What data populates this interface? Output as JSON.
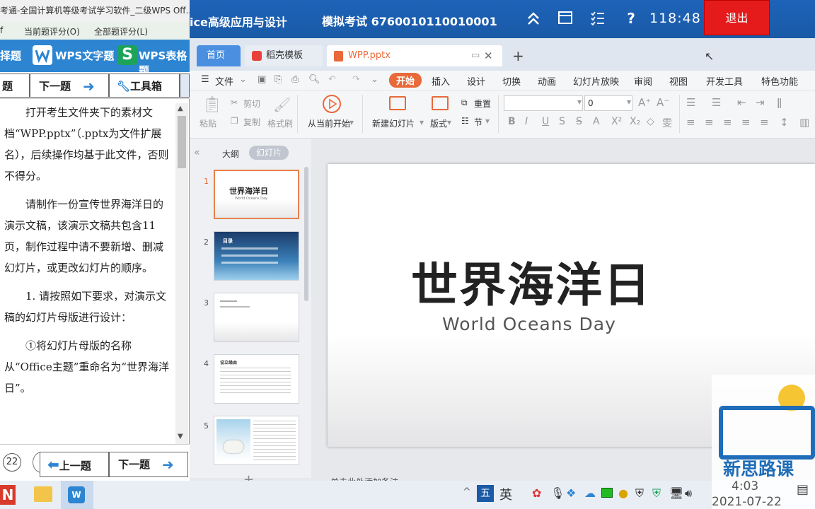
{
  "exam": {
    "title": "ice高级应用与设计",
    "mock_exam": "模拟考试 6760010110010001",
    "timer": "118:48",
    "exit_label": "退出"
  },
  "wps": {
    "tabs": [
      {
        "label": "首页"
      },
      {
        "label": "稻壳模板"
      },
      {
        "label": "WPP.pptx"
      }
    ],
    "menu": {
      "file": "文件",
      "items": [
        "开始",
        "插入",
        "设计",
        "切换",
        "动画",
        "幻灯片放映",
        "审阅",
        "视图",
        "开发工具",
        "特色功能"
      ],
      "active": "开始"
    },
    "ribbon": {
      "paste": "粘贴",
      "cut": "剪切",
      "copy": "复制",
      "format_painter": "格式刷",
      "play_from_current": "从当前开始",
      "new_slide": "新建幻灯片",
      "layout": "版式",
      "reset": "重置",
      "section": "节",
      "font_size": "0"
    },
    "pane_tabs": {
      "outline": "大纲",
      "slides": "幻灯片"
    },
    "thumbnails": [
      {
        "num": "1",
        "title": "世界海洋日",
        "subtitle": "World Oceans Day"
      },
      {
        "num": "2",
        "title": "目录"
      },
      {
        "num": "3"
      },
      {
        "num": "4",
        "title": "设立缘由"
      },
      {
        "num": "5"
      }
    ],
    "slide": {
      "title": "世界海洋日",
      "subtitle": "World Oceans Day"
    },
    "notes_placeholder": "单击此处添加备注"
  },
  "left": {
    "title": "考通-全国计算机等级考试学习软件_二级WPS Off...",
    "menu": [
      "f",
      "当前题评分(O)",
      "全部题评分(L)"
    ],
    "types": [
      "择题",
      "WPS文字题",
      "WPS表格题"
    ],
    "nav": {
      "prev": "题",
      "next": "下一题",
      "tools": "工具箱"
    },
    "paragraphs": [
      "打开考生文件夹下的素材文档“WPP.pptx”（.pptx为文件扩展名），后续操作均基于此文件，否则不得分。",
      "请制作一份宣传世界海洋日的演示文稿，该演示文稿共包含11页，制作过程中请不要新增、删减幻灯片，或更改幻灯片的顺序。",
      "1. 请按照如下要求，对演示文稿的幻灯片母版进行设计：",
      "①将幻灯片母版的名称从“Office主题”重命名为“世界海洋日”。"
    ],
    "bottom": {
      "page": "22",
      "prev": "上一题",
      "next": "下一题"
    }
  },
  "taskbar": {
    "ime": "五",
    "time": "4:03",
    "date": "2021-07-22"
  },
  "logo": {
    "text": "新思路课"
  },
  "colors": {
    "exam_bar": "#1d63b8",
    "exit": "#e51b1b",
    "wps_accent": "#e86a3a",
    "left_types": "#2d85d2"
  }
}
